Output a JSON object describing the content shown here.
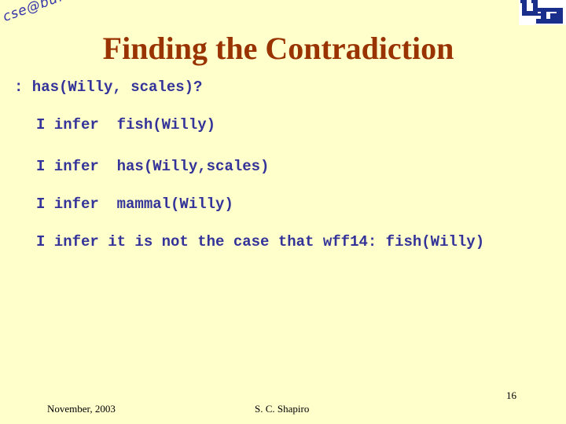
{
  "header": {
    "logo_text": "cse@buffalo",
    "title": "Finding the Contradiction"
  },
  "content": {
    "query": ": has(Willy, scales)?",
    "lines": [
      "I infer  fish(Willy)",
      "I infer  has(Willy,scales)",
      "I infer  mammal(Willy)",
      "I infer it is not the case that wff14: fish(Willy)"
    ]
  },
  "footer": {
    "date": "November, 2003",
    "author": "S. C. Shapiro",
    "page_number": "16"
  },
  "colors": {
    "background": "#ffffcc",
    "title": "#993300",
    "body_text": "#333399",
    "logo": "#1a2f8c"
  }
}
